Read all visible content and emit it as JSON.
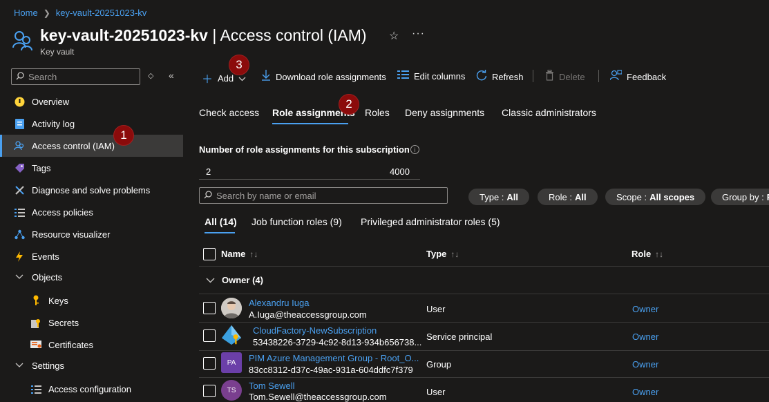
{
  "breadcrumb": {
    "home": "Home",
    "current": "key-vault-20251023-kv"
  },
  "header": {
    "title_main": "key-vault-20251023-kv",
    "title_sub": " | Access control (IAM)",
    "resource_type": "Key vault"
  },
  "sidebar": {
    "search_placeholder": "Search",
    "items": [
      {
        "label": "Overview",
        "icon": "overview-icon"
      },
      {
        "label": "Activity log",
        "icon": "activity-log-icon"
      },
      {
        "label": "Access control (IAM)",
        "icon": "iam-icon",
        "active": true
      },
      {
        "label": "Tags",
        "icon": "tag-icon"
      },
      {
        "label": "Diagnose and solve problems",
        "icon": "wrench-icon"
      },
      {
        "label": "Access policies",
        "icon": "list-icon"
      },
      {
        "label": "Resource visualizer",
        "icon": "visualizer-icon"
      },
      {
        "label": "Events",
        "icon": "lightning-icon"
      },
      {
        "label": "Objects",
        "icon": "chevron-down-icon"
      },
      {
        "label": "Keys",
        "icon": "key-icon"
      },
      {
        "label": "Secrets",
        "icon": "secret-icon"
      },
      {
        "label": "Certificates",
        "icon": "certificate-icon"
      },
      {
        "label": "Settings",
        "icon": "chevron-down-icon"
      },
      {
        "label": "Access configuration",
        "icon": "list-icon"
      }
    ]
  },
  "toolbar": {
    "add": "Add",
    "download": "Download role assignments",
    "edit_columns": "Edit columns",
    "refresh": "Refresh",
    "delete": "Delete",
    "feedback": "Feedback"
  },
  "tabs": [
    "Check access",
    "Role assignments",
    "Roles",
    "Deny assignments",
    "Classic administrators"
  ],
  "stats": {
    "label": "Number of role assignments for this subscription",
    "current": "2",
    "max": "4000"
  },
  "search": {
    "placeholder": "Search by name or email"
  },
  "filters": [
    {
      "key": "Type :",
      "value": "All"
    },
    {
      "key": "Role :",
      "value": "All"
    },
    {
      "key": "Scope :",
      "value": "All scopes"
    },
    {
      "key": "Group by :",
      "value": "R"
    }
  ],
  "subtabs": [
    "All (14)",
    "Job function roles (9)",
    "Privileged administrator roles (5)"
  ],
  "table": {
    "columns": [
      "Name",
      "Type",
      "Role"
    ],
    "group": "Owner (4)",
    "rows": [
      {
        "name": "Alexandru Iuga",
        "sub": "A.Iuga@theaccessgroup.com",
        "type": "User",
        "role": "Owner",
        "avatar": "photo"
      },
      {
        "name": "CloudFactory-NewSubscription",
        "sub": "53438226-3729-4c92-8d13-934b656738...",
        "type": "Service principal",
        "role": "Owner",
        "avatar": "app"
      },
      {
        "name": "PIM Azure Management Group - Root_O...",
        "sub": "83cc8312-d37c-49ac-931a-604ddfc7f379",
        "type": "Group",
        "role": "Owner",
        "avatar": "PA"
      },
      {
        "name": "Tom Sewell",
        "sub": "Tom.Sewell@theaccessgroup.com",
        "type": "User",
        "role": "Owner",
        "avatar": "TS"
      }
    ]
  },
  "badges": [
    "1",
    "2",
    "3"
  ],
  "colors": {
    "accent": "#4aa0f0",
    "badge": "#8b0b0b",
    "background": "#1b1a19"
  }
}
